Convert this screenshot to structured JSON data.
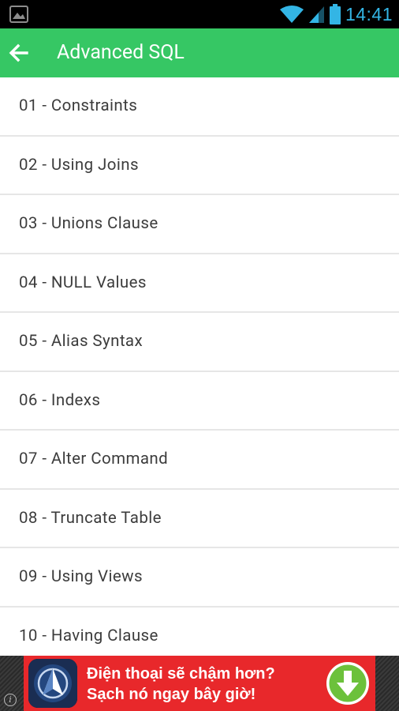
{
  "status_bar": {
    "time": "14:41",
    "icons": [
      "image-notification-icon",
      "wifi-icon",
      "signal-icon",
      "battery-icon"
    ],
    "accent_color": "#33b5e5"
  },
  "app_bar": {
    "title": "Advanced SQL",
    "back_icon": "arrow-back-icon",
    "background_color": "#36c764"
  },
  "list": {
    "items": [
      {
        "label": "01 - Constraints"
      },
      {
        "label": "02 - Using Joins"
      },
      {
        "label": "03 - Unions Clause"
      },
      {
        "label": "04 - NULL Values"
      },
      {
        "label": "05 - Alias Syntax"
      },
      {
        "label": "06 - Indexs"
      },
      {
        "label": "07 - Alter Command"
      },
      {
        "label": "08 - Truncate Table"
      },
      {
        "label": "09 - Using Views"
      },
      {
        "label": "10 - Having Clause"
      }
    ]
  },
  "ad_banner": {
    "line1": "Điện thoại sẽ chậm hơn?",
    "line2": "Sạch nó ngay bây giờ!",
    "info_icon": "info-icon",
    "download_icon": "download-arrow-icon",
    "background_color": "#e8282b"
  }
}
